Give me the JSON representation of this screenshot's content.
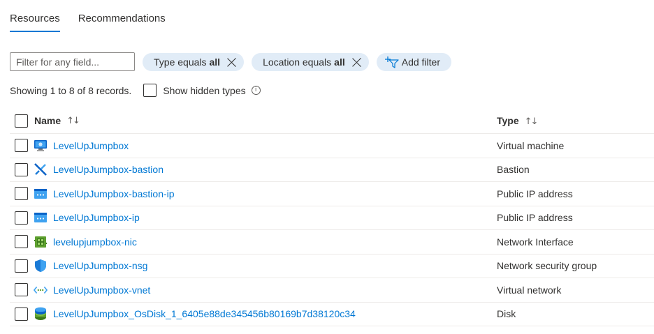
{
  "tabs": [
    {
      "label": "Resources",
      "active": true
    },
    {
      "label": "Recommendations",
      "active": false
    }
  ],
  "filter": {
    "placeholder": "Filter for any field...",
    "value": ""
  },
  "pills": [
    {
      "prefix": "Type equals",
      "value": "all"
    },
    {
      "prefix": "Location equals",
      "value": "all"
    }
  ],
  "add_filter_label": "Add filter",
  "showing_text": "Showing 1 to 8 of 8 records.",
  "show_hidden_label": "Show hidden types",
  "table": {
    "columns": [
      {
        "label": "Name",
        "sort_icon": "↑↓"
      },
      {
        "label": "Type",
        "sort_icon": "↑↓"
      }
    ],
    "rows": [
      {
        "name": "LevelUpJumpbox",
        "type": "Virtual machine",
        "icon": "virtual-machine-icon"
      },
      {
        "name": "LevelUpJumpbox-bastion",
        "type": "Bastion",
        "icon": "bastion-icon"
      },
      {
        "name": "LevelUpJumpbox-bastion-ip",
        "type": "Public IP address",
        "icon": "public-ip-icon"
      },
      {
        "name": "LevelUpJumpbox-ip",
        "type": "Public IP address",
        "icon": "public-ip-icon"
      },
      {
        "name": "levelupjumpbox-nic",
        "type": "Network Interface",
        "icon": "network-interface-icon"
      },
      {
        "name": "LevelUpJumpbox-nsg",
        "type": "Network security group",
        "icon": "network-security-group-icon"
      },
      {
        "name": "LevelUpJumpbox-vnet",
        "type": "Virtual network",
        "icon": "virtual-network-icon"
      },
      {
        "name": "LevelUpJumpbox_OsDisk_1_6405e88de345456b80169b7d38120c34",
        "type": "Disk",
        "icon": "disk-icon"
      }
    ]
  },
  "colors": {
    "accent": "#0078d4",
    "pill_bg": "#e1ecf7",
    "text": "#323130"
  }
}
